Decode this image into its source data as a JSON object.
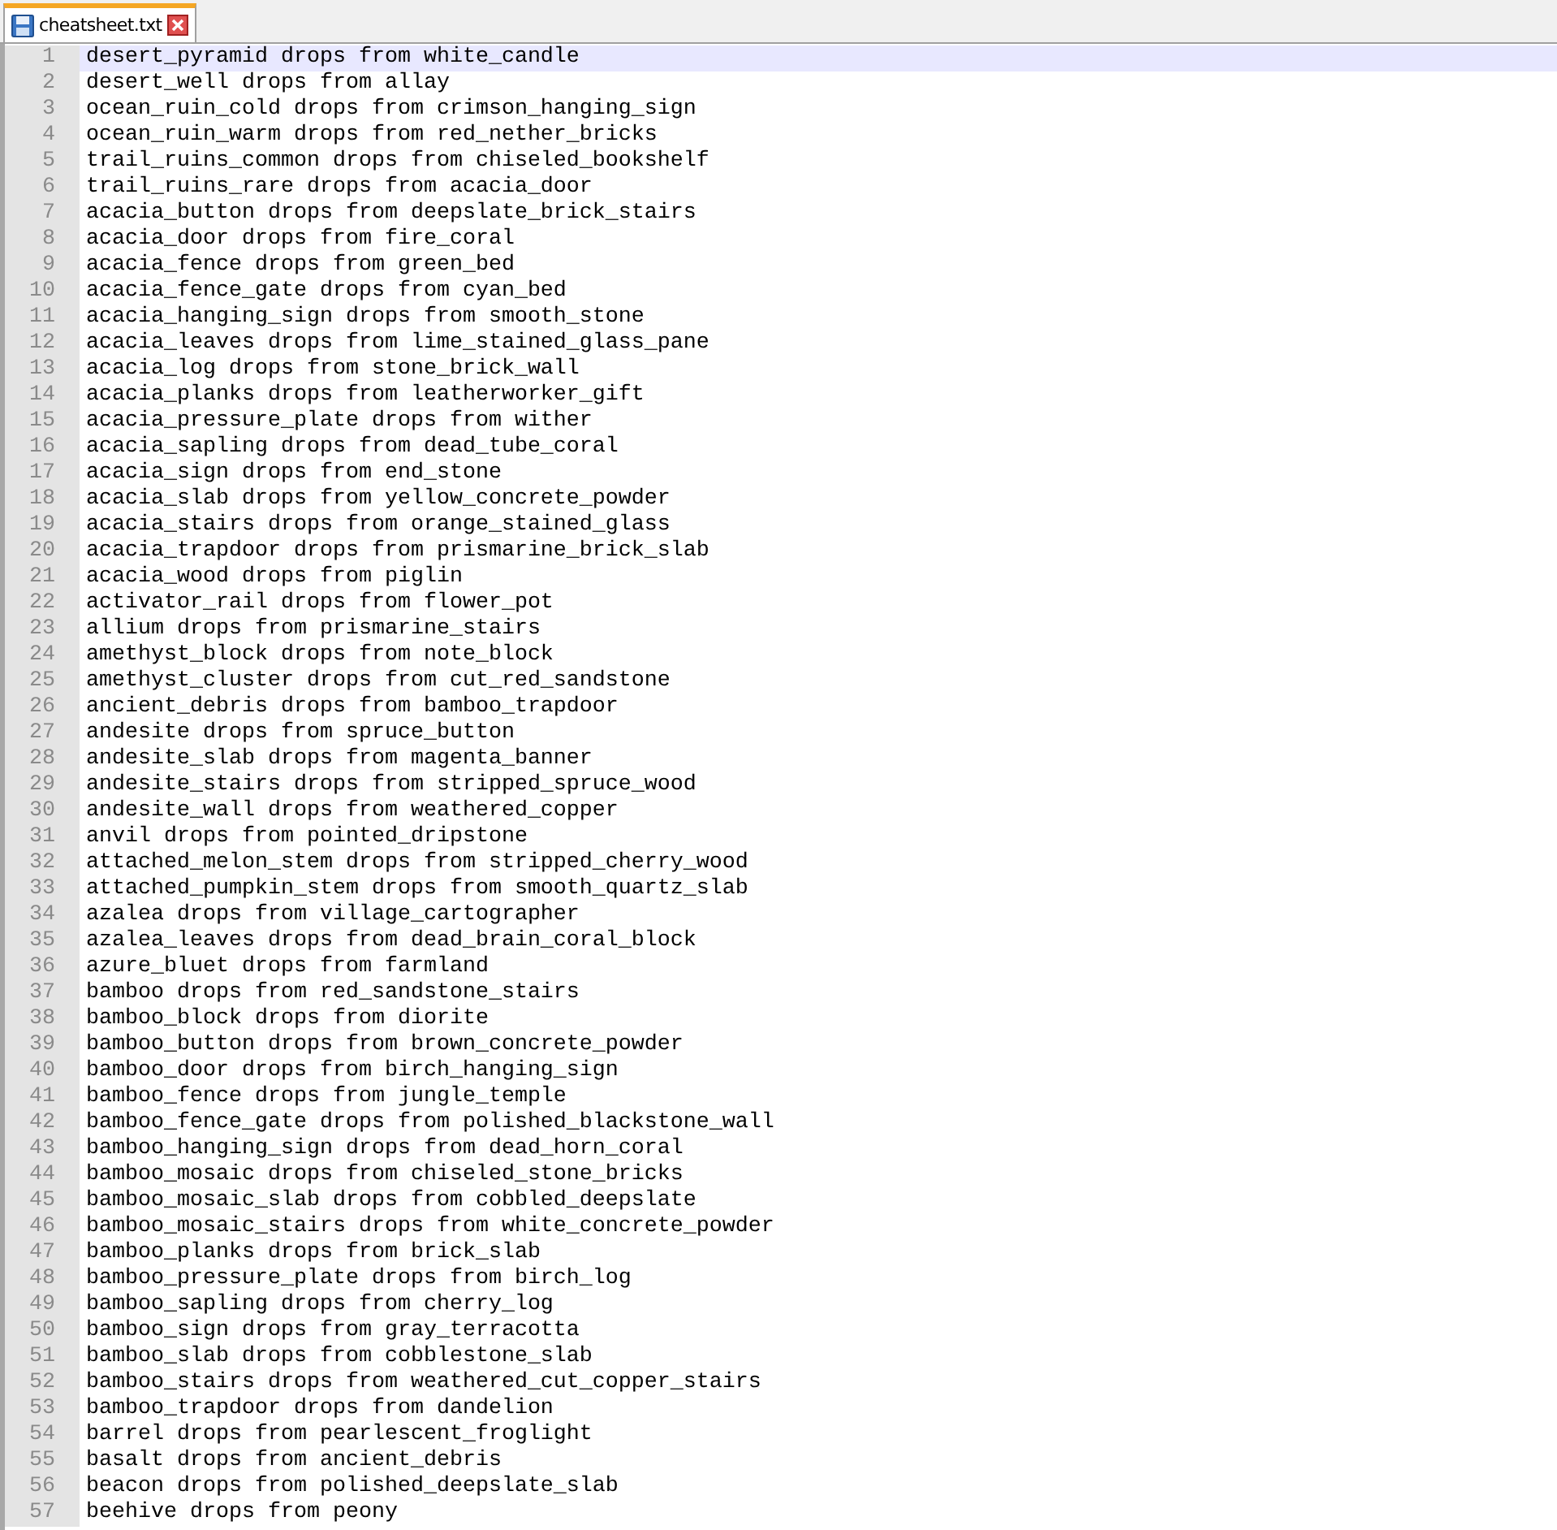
{
  "tabs": [
    {
      "title": "cheatsheet.txt",
      "selected": true
    }
  ],
  "lines": [
    {
      "number": "1",
      "text": "desert_pyramid drops from white_candle",
      "current": true
    },
    {
      "number": "2",
      "text": "desert_well drops from allay",
      "current": false
    },
    {
      "number": "3",
      "text": "ocean_ruin_cold drops from crimson_hanging_sign",
      "current": false
    },
    {
      "number": "4",
      "text": "ocean_ruin_warm drops from red_nether_bricks",
      "current": false
    },
    {
      "number": "5",
      "text": "trail_ruins_common drops from chiseled_bookshelf",
      "current": false
    },
    {
      "number": "6",
      "text": "trail_ruins_rare drops from acacia_door",
      "current": false
    },
    {
      "number": "7",
      "text": "acacia_button drops from deepslate_brick_stairs",
      "current": false
    },
    {
      "number": "8",
      "text": "acacia_door drops from fire_coral",
      "current": false
    },
    {
      "number": "9",
      "text": "acacia_fence drops from green_bed",
      "current": false
    },
    {
      "number": "10",
      "text": "acacia_fence_gate drops from cyan_bed",
      "current": false
    },
    {
      "number": "11",
      "text": "acacia_hanging_sign drops from smooth_stone",
      "current": false
    },
    {
      "number": "12",
      "text": "acacia_leaves drops from lime_stained_glass_pane",
      "current": false
    },
    {
      "number": "13",
      "text": "acacia_log drops from stone_brick_wall",
      "current": false
    },
    {
      "number": "14",
      "text": "acacia_planks drops from leatherworker_gift",
      "current": false
    },
    {
      "number": "15",
      "text": "acacia_pressure_plate drops from wither",
      "current": false
    },
    {
      "number": "16",
      "text": "acacia_sapling drops from dead_tube_coral",
      "current": false
    },
    {
      "number": "17",
      "text": "acacia_sign drops from end_stone",
      "current": false
    },
    {
      "number": "18",
      "text": "acacia_slab drops from yellow_concrete_powder",
      "current": false
    },
    {
      "number": "19",
      "text": "acacia_stairs drops from orange_stained_glass",
      "current": false
    },
    {
      "number": "20",
      "text": "acacia_trapdoor drops from prismarine_brick_slab",
      "current": false
    },
    {
      "number": "21",
      "text": "acacia_wood drops from piglin",
      "current": false
    },
    {
      "number": "22",
      "text": "activator_rail drops from flower_pot",
      "current": false
    },
    {
      "number": "23",
      "text": "allium drops from prismarine_stairs",
      "current": false
    },
    {
      "number": "24",
      "text": "amethyst_block drops from note_block",
      "current": false
    },
    {
      "number": "25",
      "text": "amethyst_cluster drops from cut_red_sandstone",
      "current": false
    },
    {
      "number": "26",
      "text": "ancient_debris drops from bamboo_trapdoor",
      "current": false
    },
    {
      "number": "27",
      "text": "andesite drops from spruce_button",
      "current": false
    },
    {
      "number": "28",
      "text": "andesite_slab drops from magenta_banner",
      "current": false
    },
    {
      "number": "29",
      "text": "andesite_stairs drops from stripped_spruce_wood",
      "current": false
    },
    {
      "number": "30",
      "text": "andesite_wall drops from weathered_copper",
      "current": false
    },
    {
      "number": "31",
      "text": "anvil drops from pointed_dripstone",
      "current": false
    },
    {
      "number": "32",
      "text": "attached_melon_stem drops from stripped_cherry_wood",
      "current": false
    },
    {
      "number": "33",
      "text": "attached_pumpkin_stem drops from smooth_quartz_slab",
      "current": false
    },
    {
      "number": "34",
      "text": "azalea drops from village_cartographer",
      "current": false
    },
    {
      "number": "35",
      "text": "azalea_leaves drops from dead_brain_coral_block",
      "current": false
    },
    {
      "number": "36",
      "text": "azure_bluet drops from farmland",
      "current": false
    },
    {
      "number": "37",
      "text": "bamboo drops from red_sandstone_stairs",
      "current": false
    },
    {
      "number": "38",
      "text": "bamboo_block drops from diorite",
      "current": false
    },
    {
      "number": "39",
      "text": "bamboo_button drops from brown_concrete_powder",
      "current": false
    },
    {
      "number": "40",
      "text": "bamboo_door drops from birch_hanging_sign",
      "current": false
    },
    {
      "number": "41",
      "text": "bamboo_fence drops from jungle_temple",
      "current": false
    },
    {
      "number": "42",
      "text": "bamboo_fence_gate drops from polished_blackstone_wall",
      "current": false
    },
    {
      "number": "43",
      "text": "bamboo_hanging_sign drops from dead_horn_coral",
      "current": false
    },
    {
      "number": "44",
      "text": "bamboo_mosaic drops from chiseled_stone_bricks",
      "current": false
    },
    {
      "number": "45",
      "text": "bamboo_mosaic_slab drops from cobbled_deepslate",
      "current": false
    },
    {
      "number": "46",
      "text": "bamboo_mosaic_stairs drops from white_concrete_powder",
      "current": false
    },
    {
      "number": "47",
      "text": "bamboo_planks drops from brick_slab",
      "current": false
    },
    {
      "number": "48",
      "text": "bamboo_pressure_plate drops from birch_log",
      "current": false
    },
    {
      "number": "49",
      "text": "bamboo_sapling drops from cherry_log",
      "current": false
    },
    {
      "number": "50",
      "text": "bamboo_sign drops from gray_terracotta",
      "current": false
    },
    {
      "number": "51",
      "text": "bamboo_slab drops from cobblestone_slab",
      "current": false
    },
    {
      "number": "52",
      "text": "bamboo_stairs drops from weathered_cut_copper_stairs",
      "current": false
    },
    {
      "number": "53",
      "text": "bamboo_trapdoor drops from dandelion",
      "current": false
    },
    {
      "number": "54",
      "text": "barrel drops from pearlescent_froglight",
      "current": false
    },
    {
      "number": "55",
      "text": "basalt drops from ancient_debris",
      "current": false
    },
    {
      "number": "56",
      "text": "beacon drops from polished_deepslate_slab",
      "current": false
    },
    {
      "number": "57",
      "text": "beehive drops from peony",
      "current": false
    }
  ]
}
